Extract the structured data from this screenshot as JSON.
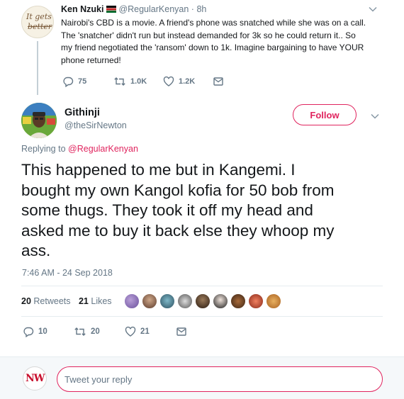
{
  "parent_tweet": {
    "avatar_text": [
      "It gets",
      "better"
    ],
    "name": "Ken Nzuki",
    "handle": "@RegularKenyan",
    "separator": "·",
    "time": "8h",
    "lines": [
      "Nairobi's CBD is a movie. A friend's phone was snatched while she was on a call.",
      "The 'snatcher' didn't run but instead demanded for 3k so he could return it.. So",
      "my friend negotiated the 'ransom' down to 1k. Imagine bargaining to have YOUR",
      "phone returned!"
    ],
    "reply_count": "75",
    "retweet_count": "1.0K",
    "like_count": "1.2K"
  },
  "main_tweet": {
    "name": "Githinji",
    "handle": "@theSirNewton",
    "follow_label": "Follow",
    "replying_prefix": "Replying to",
    "replying_to": "@RegularKenyan",
    "text_lines": [
      "This happened to me but in Kangemi. I",
      "bought my own Kangol kofia for 50 bob from",
      "some thugs. They took it off my head and",
      "asked me to buy it back else they whoop my",
      "ass."
    ],
    "timestamp": "7:46 AM - 24 Sep 2018",
    "retweets_count": "20",
    "retweets_label": "Retweets",
    "likes_count": "21",
    "likes_label": "Likes",
    "reply_count": "10",
    "retweet_count": "20",
    "like_count": "21"
  },
  "reply_box": {
    "logo_text": "NW",
    "placeholder": "Tweet your reply"
  },
  "colors": {
    "accent": "#e0245e",
    "secondary_text": "#657786",
    "primary_text": "#14171a"
  },
  "icons": [
    "reply-icon",
    "retweet-icon",
    "heart-icon",
    "message-icon",
    "chevron-down-icon",
    "kenya-flag-icon"
  ]
}
